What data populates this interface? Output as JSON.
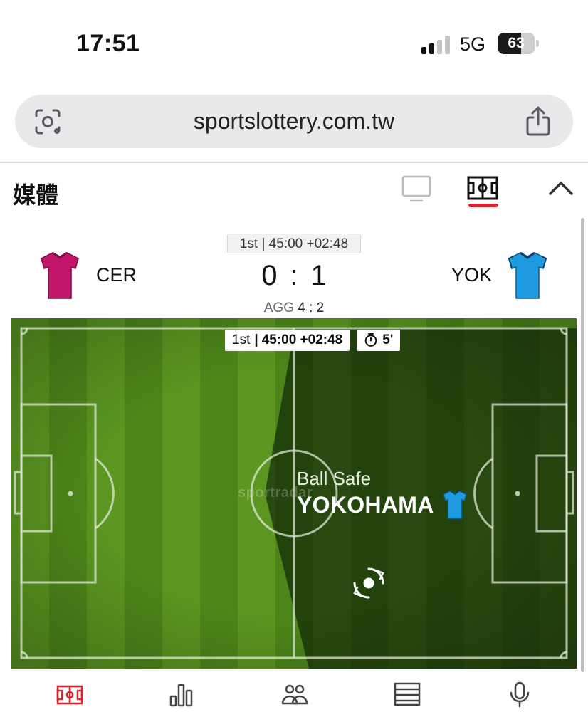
{
  "status_bar": {
    "time": "17:51",
    "network": "5G",
    "battery_level": "63",
    "battery_fraction": 0.63
  },
  "browser": {
    "url": "sportslottery.com.tw",
    "left_icon": "visual-search-icon",
    "right_icon": "share-icon"
  },
  "media": {
    "title": "媒體",
    "icons": [
      "tv-icon",
      "pitch-icon",
      "chevron-up-icon"
    ],
    "active_tab": "pitch-icon",
    "accent_color": "#d8242d"
  },
  "scoreboard": {
    "period": "1st | 45:00 +02:48",
    "home": {
      "abbr": "CER",
      "score": "0",
      "jersey_color": "#c2166b"
    },
    "away": {
      "abbr": "YOK",
      "score": "1",
      "jersey_color": "#1e9be0"
    },
    "separator": ":",
    "agg_label": "AGG",
    "agg_score": "4 : 2"
  },
  "field": {
    "period": "1st",
    "clock": "45:00 +02:48",
    "stoppage": "5'",
    "event": "Ball Safe",
    "event_team": "YOKOHAMA",
    "watermark": "sportradar",
    "grass_color": "#4f8a1c"
  },
  "bottom_nav": {
    "items": [
      "pitch-icon",
      "stats-icon",
      "lineups-icon",
      "standings-icon",
      "commentary-mic-icon"
    ],
    "active": "pitch-icon"
  }
}
